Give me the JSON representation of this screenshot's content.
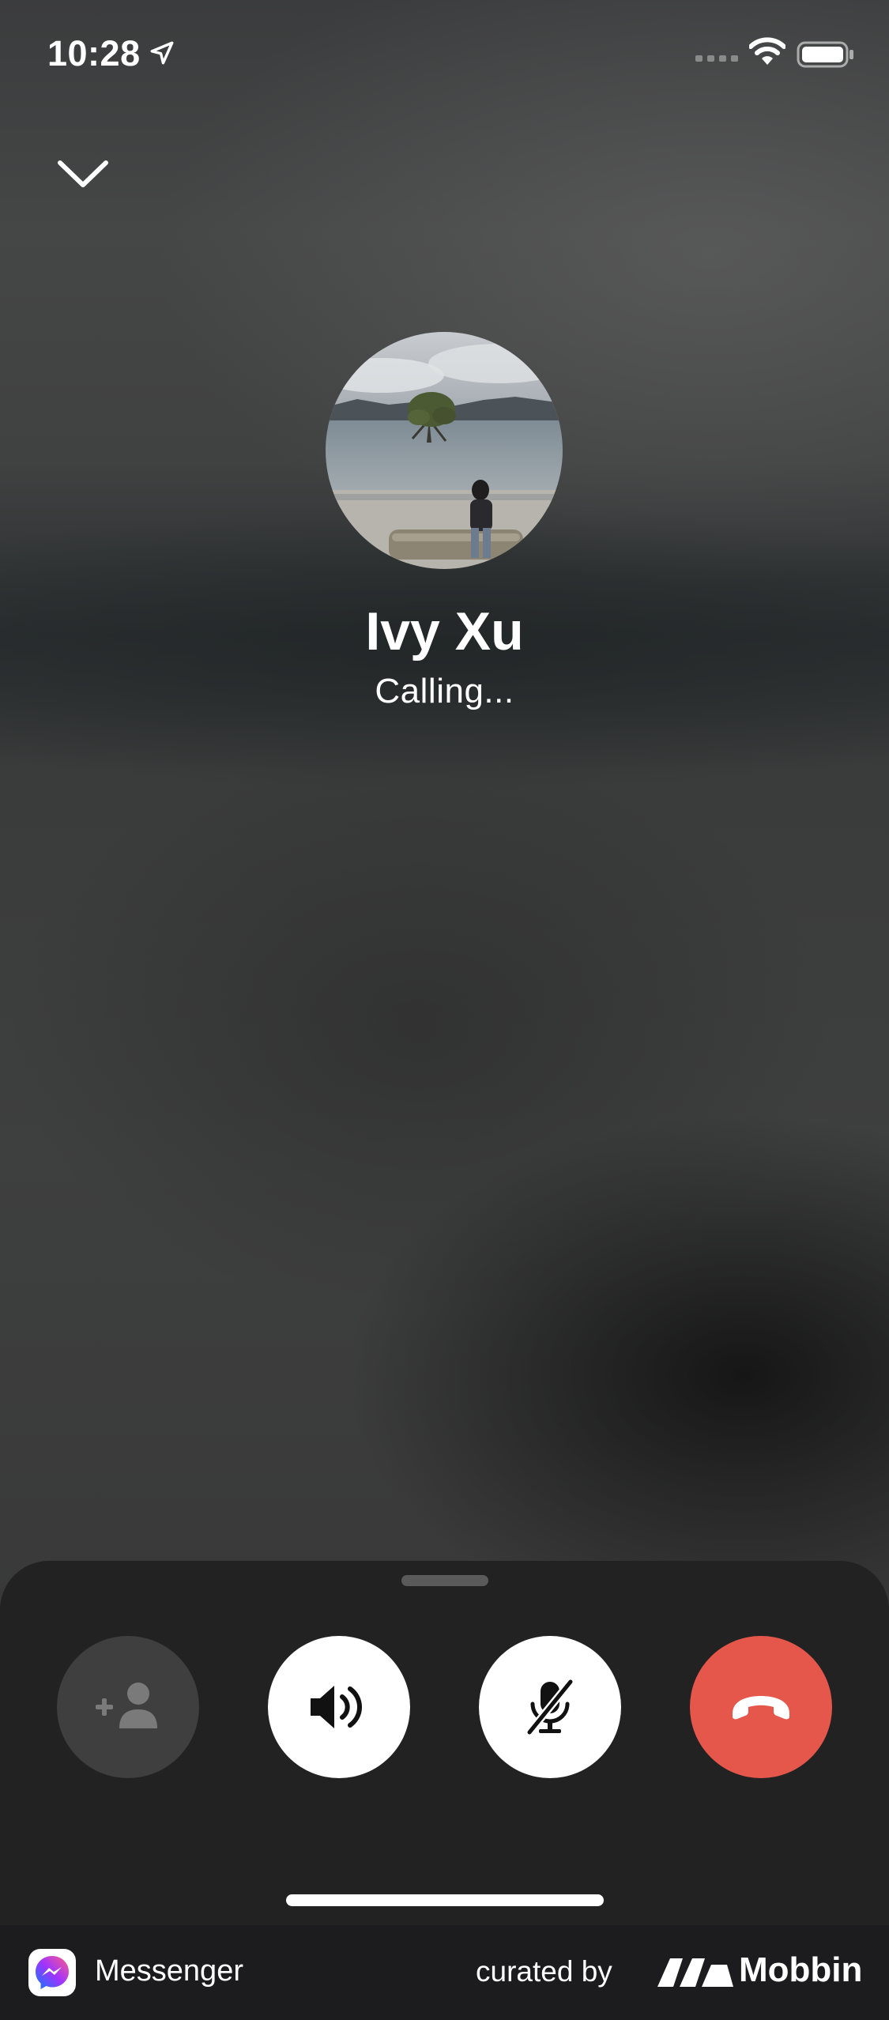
{
  "status_bar": {
    "time": "10:28",
    "location_icon": "location-arrow-icon",
    "signal_icon": "cellular-signal-icon",
    "wifi_icon": "wifi-icon",
    "battery_icon": "battery-icon"
  },
  "header": {
    "collapse_icon": "chevron-down-icon"
  },
  "call": {
    "caller_name": "Ivy Xu",
    "status": "Calling...",
    "avatar_icon": "contact-photo"
  },
  "controls": {
    "add_person_icon": "add-person-icon",
    "speaker_icon": "speaker-icon",
    "mute_icon": "microphone-off-icon",
    "end_call_icon": "end-call-icon",
    "end_call_color": "#e5574b"
  },
  "footer": {
    "app_name": "Messenger",
    "curated_by": "curated by",
    "brand": "Mobbin"
  }
}
